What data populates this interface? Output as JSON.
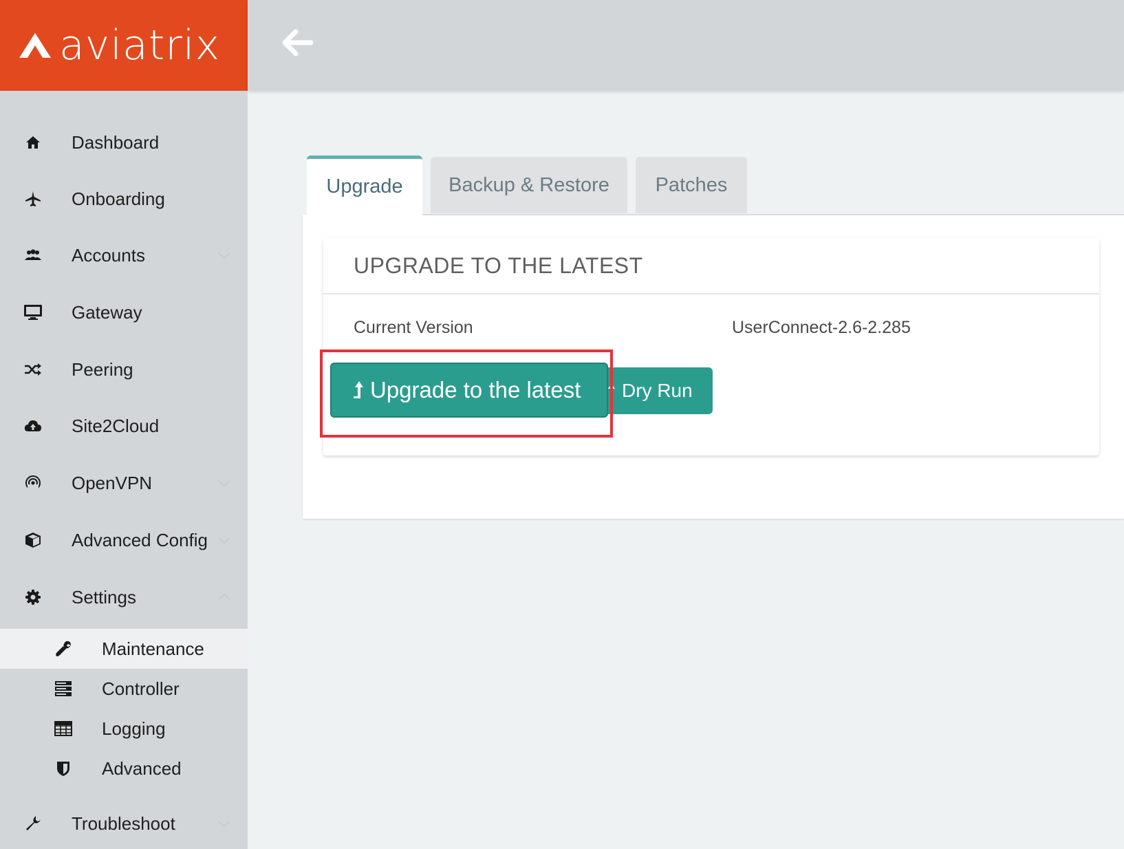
{
  "brand": {
    "name": "aviatrix",
    "color": "#e2491e"
  },
  "header": {
    "back_icon": "back-arrow-icon"
  },
  "sidebar": {
    "items": [
      {
        "label": "Dashboard",
        "icon": "home-icon"
      },
      {
        "label": "Onboarding",
        "icon": "airplane-icon"
      },
      {
        "label": "Accounts",
        "icon": "users-icon",
        "expandable": true
      },
      {
        "label": "Gateway",
        "icon": "monitor-icon"
      },
      {
        "label": "Peering",
        "icon": "shuffle-icon"
      },
      {
        "label": "Site2Cloud",
        "icon": "cloud-upload-icon"
      },
      {
        "label": "OpenVPN",
        "icon": "broadcast-icon",
        "expandable": true
      },
      {
        "label": "Advanced Config",
        "icon": "cube-icon",
        "expandable": true
      },
      {
        "label": "Settings",
        "icon": "gear-icon",
        "expandable": true,
        "expanded": true
      }
    ],
    "settings_children": [
      {
        "label": "Maintenance",
        "icon": "wrench-icon",
        "active": true
      },
      {
        "label": "Controller",
        "icon": "server-icon"
      },
      {
        "label": "Logging",
        "icon": "table-icon"
      },
      {
        "label": "Advanced",
        "icon": "shield-icon"
      }
    ],
    "bottom_item": {
      "label": "Troubleshoot",
      "icon": "wrench-icon",
      "expandable": true
    }
  },
  "tabs": [
    {
      "label": "Upgrade",
      "active": true
    },
    {
      "label": "Backup & Restore"
    },
    {
      "label": "Patches"
    }
  ],
  "panel": {
    "title": "UPGRADE TO THE LATEST",
    "current_version_label": "Current Version",
    "current_version_value": "UserConnect-2.6-2.285",
    "upgrade_button": "Upgrade to the latest",
    "dry_run_button": "Dry Run"
  },
  "colors": {
    "accent": "#2a9d8f",
    "highlight": "#e5333a",
    "tab_active_border": "#5fb3b0"
  }
}
